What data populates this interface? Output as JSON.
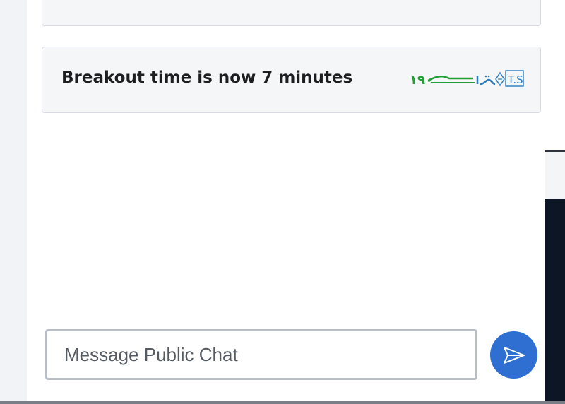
{
  "messages": [
    {
      "text": ""
    },
    {
      "text": "Breakout time is now 7 minutes"
    }
  ],
  "composer": {
    "placeholder": "Message Public Chat",
    "value": ""
  },
  "colors": {
    "send_button": "#2f6fd1",
    "logo_blue": "#2a7bbf",
    "logo_green": "#21a038"
  },
  "icons": {
    "send": "send-arrow-icon",
    "logo": "tehran-logo"
  }
}
